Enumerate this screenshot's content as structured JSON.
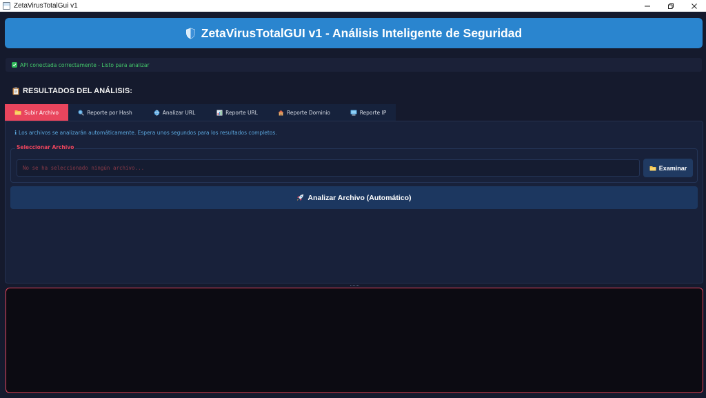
{
  "window": {
    "title": "ZetaVirusTotalGui v1"
  },
  "header": {
    "title": "ZetaVirusTotalGUI v1 - Análisis Inteligente de Seguridad",
    "icon": "shield-icon",
    "color": "#2a85cf"
  },
  "status": {
    "text": "API conectada correctamente - Listo para analizar",
    "icon": "check-icon",
    "color": "#43c86a"
  },
  "results": {
    "heading": "RESULTADOS DEL ANÁLISIS:",
    "icon": "clipboard-icon"
  },
  "tabs": [
    {
      "label": "Subir Archivo",
      "icon": "folder-icon",
      "active": true
    },
    {
      "label": "Reporte por Hash",
      "icon": "magnifier-icon",
      "active": false
    },
    {
      "label": "Analizar URL",
      "icon": "globe-icon",
      "active": false
    },
    {
      "label": "Reporte URL",
      "icon": "bar-chart-icon",
      "active": false
    },
    {
      "label": "Reporte Dominio",
      "icon": "house-icon",
      "active": false
    },
    {
      "label": "Reporte IP",
      "icon": "computer-icon",
      "active": false
    }
  ],
  "upload": {
    "info": "Los archivos se analizarán automáticamente. Espera unos segundos para los resultados completos.",
    "group_label": "Seleccionar Archivo",
    "file_placeholder": "No se ha seleccionado ningún archivo...",
    "browse_label": "Examinar",
    "analyze_label": "Analizar Archivo (Automático)",
    "analyze_icon": "rocket-icon"
  },
  "colors": {
    "accent": "#e9455d",
    "background": "#151a2d",
    "panel": "#18213a",
    "button": "#1c3760",
    "info_text": "#5ba7de"
  }
}
